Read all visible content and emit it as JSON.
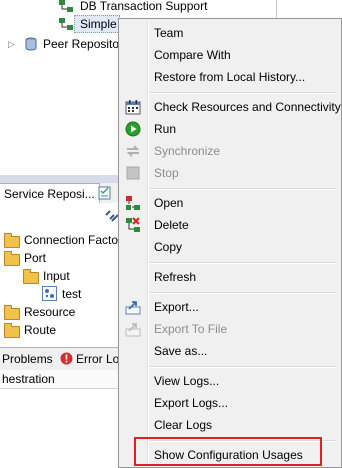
{
  "repo_tree": {
    "items": [
      {
        "label": "DB Transaction Support"
      },
      {
        "label": "Simple"
      },
      {
        "label": "Peer Repositor"
      }
    ]
  },
  "lower_view": {
    "tab_label": "Service Reposi...",
    "tree": [
      {
        "label": "Connection Facto"
      },
      {
        "label": "Port"
      },
      {
        "label": "Input"
      },
      {
        "label": "test"
      },
      {
        "label": "Resource"
      },
      {
        "label": "Route"
      }
    ]
  },
  "bottom_panel": {
    "tabs": [
      {
        "label": "Problems"
      },
      {
        "label": "Error Lo"
      }
    ],
    "column_header": "hestration"
  },
  "context_menu": {
    "groups": [
      [
        {
          "label": "Team",
          "icon": "none"
        },
        {
          "label": "Compare With",
          "icon": "none"
        },
        {
          "label": "Restore from Local History...",
          "icon": "none"
        }
      ],
      [
        {
          "label": "Check Resources and Connectivity",
          "icon": "check-resources-icon"
        },
        {
          "label": "Run",
          "icon": "run-icon"
        },
        {
          "label": "Synchronize",
          "icon": "synchronize-icon",
          "disabled": true
        },
        {
          "label": "Stop",
          "icon": "stop-icon",
          "disabled": true
        }
      ],
      [
        {
          "label": "Open",
          "icon": "open-icon"
        },
        {
          "label": "Delete",
          "icon": "delete-icon"
        },
        {
          "label": "Copy",
          "icon": "none"
        }
      ],
      [
        {
          "label": "Refresh",
          "icon": "none"
        }
      ],
      [
        {
          "label": "Export...",
          "icon": "export-icon"
        },
        {
          "label": "Export To File",
          "icon": "export-to-file-icon",
          "disabled": true
        },
        {
          "label": "Save as...",
          "icon": "none"
        }
      ],
      [
        {
          "label": "View Logs...",
          "icon": "none"
        },
        {
          "label": "Export Logs...",
          "icon": "none"
        },
        {
          "label": "Clear Logs",
          "icon": "none"
        }
      ],
      [
        {
          "label": "Show Configuration Usages",
          "icon": "none"
        }
      ]
    ],
    "highlight_color": "#e02020"
  }
}
